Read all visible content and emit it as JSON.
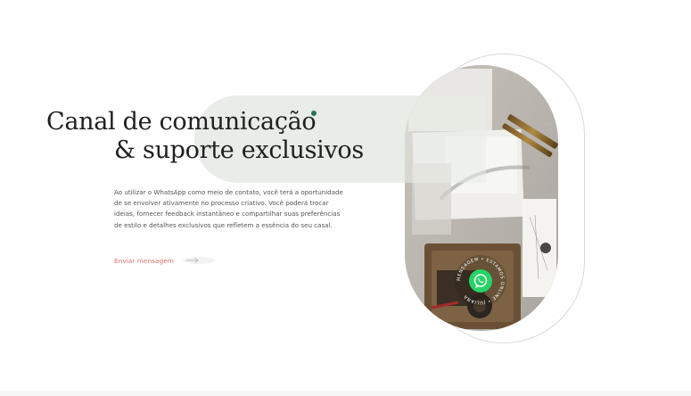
{
  "hero": {
    "headline_line1": "Canal de comunicação",
    "headline_line2": "& suporte exclusivos",
    "body": "Ao utilizar o WhatsApp como meio de contato, você terá a oportunidade de se envolver ativamente no processo criativo. Você poderá trocar ideias, fornecer feedback instantâneo e compartilhar suas preferências de estilo e detalhes exclusivos que refletem a essência do seu casal.",
    "cta_label": "Enviar mensagem",
    "cta_icon": "arrow-right-icon"
  },
  "whatsapp_badge": {
    "icon": "whatsapp-icon",
    "ring_text": "MENSAGEM • ESTAMOS ONLINE • JULIANA"
  },
  "colors": {
    "accent_dot": "#2e6f5e",
    "cta": "#d9736f",
    "pill": "#e7ece6",
    "whatsapp_green": "#25d366",
    "headline": "#1f1f1f"
  }
}
